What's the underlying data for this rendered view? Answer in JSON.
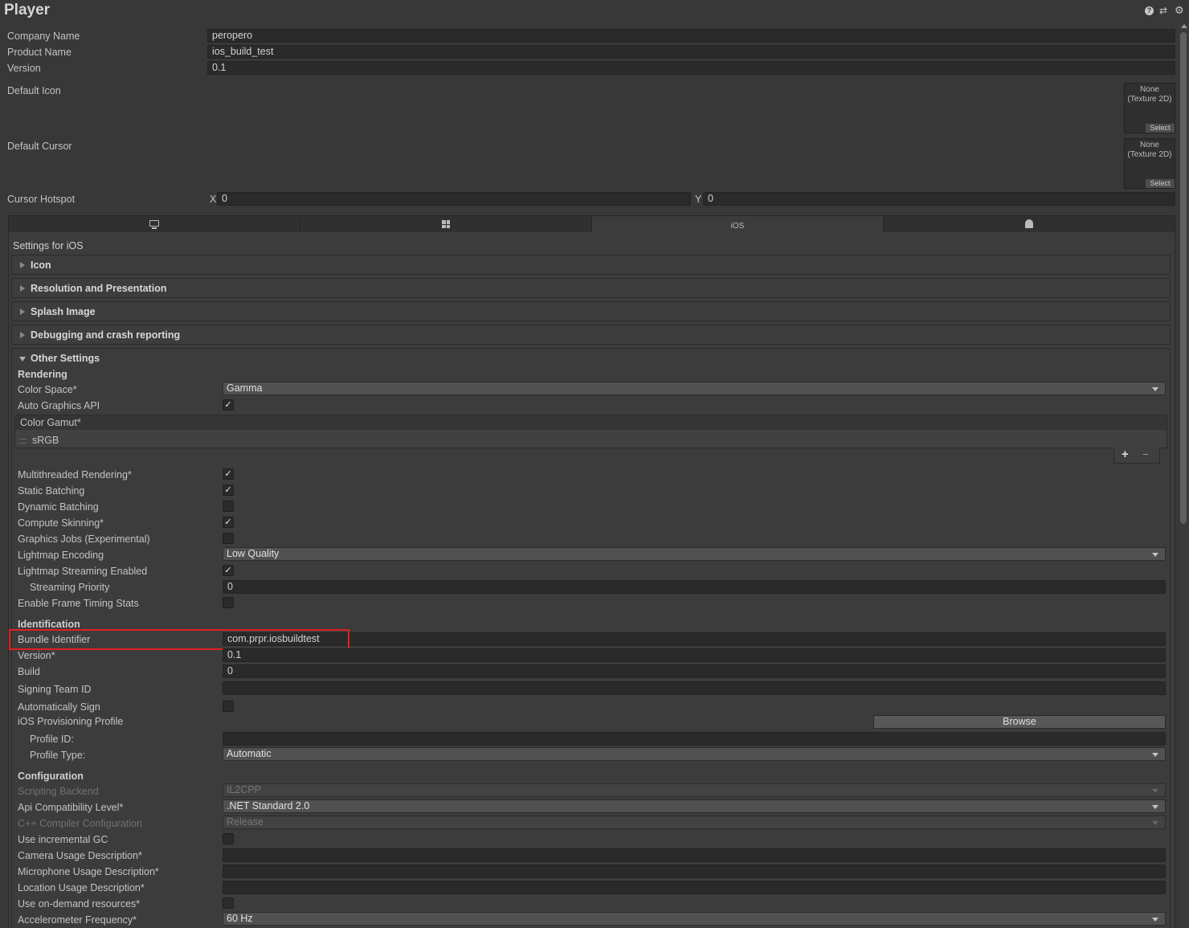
{
  "header": {
    "title": "Player"
  },
  "player": {
    "company_label": "Company Name",
    "company_value": "peropero",
    "product_label": "Product Name",
    "product_value": "ios_build_test",
    "version_label": "Version",
    "version_value": "0.1",
    "icon_label": "Default Icon",
    "cursor_label": "Default Cursor",
    "texture_none": "None",
    "texture_type": "(Texture 2D)",
    "texture_select": "Select",
    "hotspot_label": "Cursor Hotspot",
    "hotspot_x_label": "X",
    "hotspot_x": "0",
    "hotspot_y_label": "Y",
    "hotspot_y": "0"
  },
  "tabs": [
    {
      "icon": "desktop-icon"
    },
    {
      "icon": "windows-icon"
    },
    {
      "label": "iOS"
    },
    {
      "icon": "android-icon"
    }
  ],
  "settings_title": "Settings for iOS",
  "sections": [
    "Icon",
    "Resolution and Presentation",
    "Splash Image",
    "Debugging and crash reporting",
    "Other Settings"
  ],
  "other": {
    "rendering": "Rendering",
    "color_space_label": "Color Space*",
    "color_space": "Gamma",
    "auto_graphics_label": "Auto Graphics API",
    "color_gamut_label": "Color Gamut*",
    "color_gamut_item": "sRGB",
    "add_sym": "+",
    "remove_sym": "−",
    "multithreaded_label": "Multithreaded Rendering*",
    "static_batching_label": "Static Batching",
    "dynamic_batching_label": "Dynamic Batching",
    "compute_skinning_label": "Compute Skinning*",
    "graphics_jobs_label": "Graphics Jobs (Experimental)",
    "lightmap_encoding_label": "Lightmap Encoding",
    "lightmap_encoding": "Low Quality",
    "lightmap_streaming_label": "Lightmap Streaming Enabled",
    "streaming_priority_label": "Streaming Priority",
    "streaming_priority": "0",
    "frame_timing_label": "Enable Frame Timing Stats",
    "identification": "Identification",
    "bundle_id_label": "Bundle Identifier",
    "bundle_id": "com.prpr.iosbuildtest",
    "version_label": "Version*",
    "version": "0.1",
    "build_label": "Build",
    "build": "0",
    "signing_team_label": "Signing Team ID",
    "signing_team": "",
    "auto_sign_label": "Automatically Sign",
    "provisioning_label": "iOS Provisioning Profile",
    "browse": "Browse",
    "profile_id_label": "Profile ID:",
    "profile_id": "",
    "profile_type_label": "Profile Type:",
    "profile_type": "Automatic",
    "configuration": "Configuration",
    "scripting_backend_label": "Scripting Backend",
    "scripting_backend": "IL2CPP",
    "api_compat_label": "Api Compatibility Level*",
    "api_compat": ".NET Standard 2.0",
    "cpp_config_label": "C++ Compiler Configuration",
    "cpp_config": "Release",
    "incremental_gc_label": "Use incremental GC",
    "camera_usage_label": "Camera Usage Description*",
    "microphone_usage_label": "Microphone Usage Description*",
    "location_usage_label": "Location Usage Description*",
    "on_demand_label": "Use on-demand resources*",
    "accelerometer_label": "Accelerometer Frequency*",
    "accelerometer": "60 Hz"
  },
  "check_glyph": "✓",
  "colors": {
    "highlight": "#e02020"
  }
}
